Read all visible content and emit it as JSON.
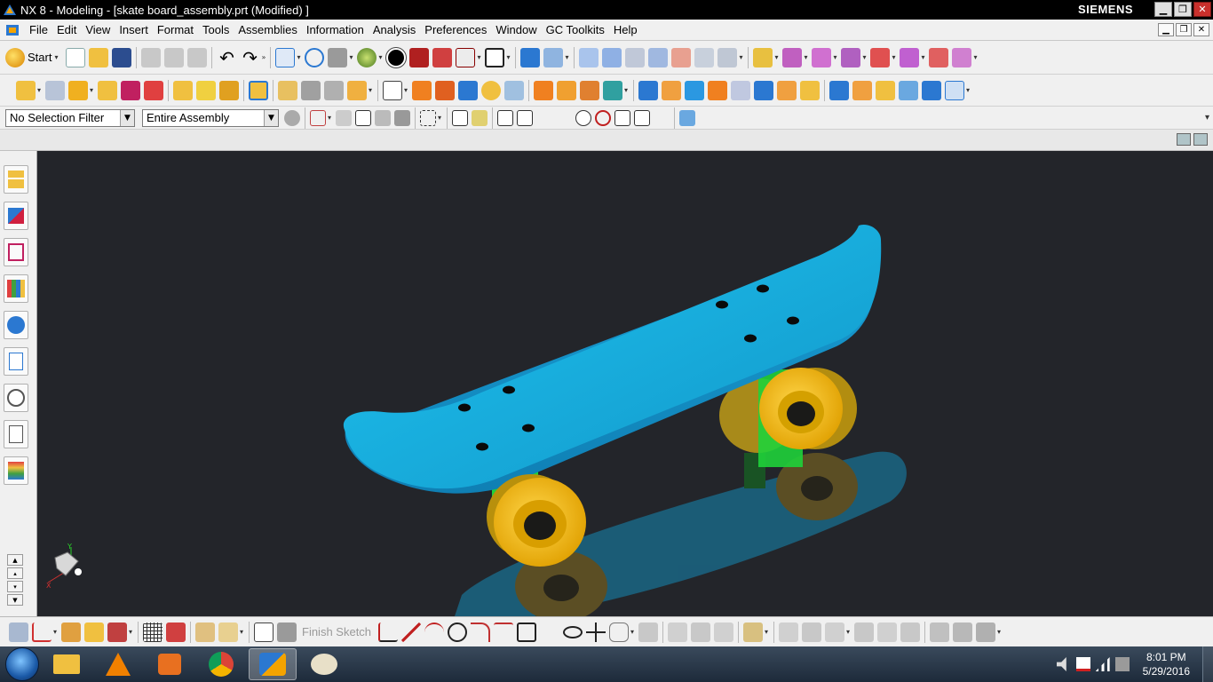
{
  "window": {
    "title": "NX 8 - Modeling - [skate board_assembly.prt (Modified) ]",
    "brand": "SIEMENS"
  },
  "menu": {
    "items": [
      {
        "label": "File"
      },
      {
        "label": "Edit"
      },
      {
        "label": "View"
      },
      {
        "label": "Insert"
      },
      {
        "label": "Format"
      },
      {
        "label": "Tools"
      },
      {
        "label": "Assemblies"
      },
      {
        "label": "Information"
      },
      {
        "label": "Analysis"
      },
      {
        "label": "Preferences"
      },
      {
        "label": "Window"
      },
      {
        "label": "GC Toolkits"
      },
      {
        "label": "Help"
      }
    ]
  },
  "toolbar": {
    "start_label": "Start",
    "selection_filter": "No Selection Filter",
    "scope": "Entire Assembly"
  },
  "sketch": {
    "finish_label": "Finish Sketch"
  },
  "taskbar": {
    "time": "8:01 PM",
    "date": "5/29/2016"
  },
  "colors": {
    "viewport_bg": "#23252a",
    "deck": "#1aa7d8",
    "wheel": "#f2b300",
    "truck": "#1fd13a"
  }
}
